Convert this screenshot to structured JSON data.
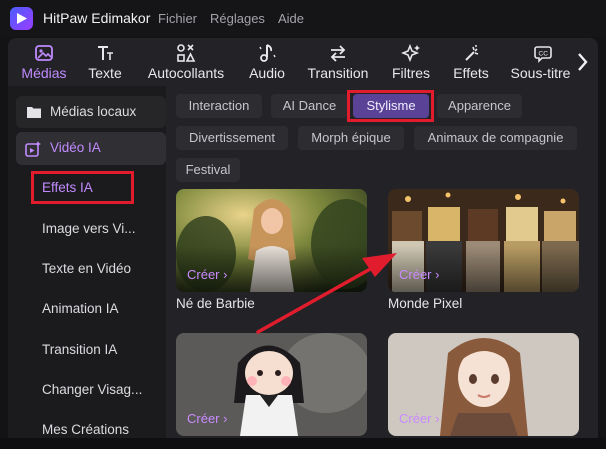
{
  "app": {
    "title": "HitPaw Edimakor"
  },
  "menu": {
    "items": [
      "Fichier",
      "Réglages",
      "Aide"
    ]
  },
  "toolbar": {
    "items": [
      {
        "label": "Médias",
        "icon": "media-icon"
      },
      {
        "label": "Texte",
        "icon": "text-icon"
      },
      {
        "label": "Autocollants",
        "icon": "stickers-icon"
      },
      {
        "label": "Audio",
        "icon": "audio-icon"
      },
      {
        "label": "Transition",
        "icon": "transition-icon"
      },
      {
        "label": "Filtres",
        "icon": "filters-icon"
      },
      {
        "label": "Effets",
        "icon": "effects-icon"
      },
      {
        "label": "Sous-titres",
        "icon": "subtitles-icon"
      }
    ],
    "active": "Médias",
    "next_icon": "chevron-right-icon"
  },
  "sidebar": {
    "items": [
      {
        "label": "Médias locaux",
        "icon": "folder-icon"
      },
      {
        "label": "Vidéo IA",
        "icon": "ai-video-icon"
      },
      {
        "label": "Effets IA"
      },
      {
        "label": "Image vers Vi..."
      },
      {
        "label": "Texte en Vidéo"
      },
      {
        "label": "Animation IA"
      },
      {
        "label": "Transition IA"
      },
      {
        "label": "Changer Visag..."
      },
      {
        "label": "Mes Créations"
      }
    ]
  },
  "categories": {
    "items": [
      "Interaction",
      "AI Dance",
      "Stylisme",
      "Apparence",
      "Divertissement",
      "Morph épique",
      "Animaux de compagnie",
      "Festival"
    ],
    "active": "Stylisme"
  },
  "cards": [
    {
      "title": "Né de Barbie",
      "cta": "Créer ›"
    },
    {
      "title": "Monde Pixel",
      "cta": "Créer ›"
    },
    {
      "title": "",
      "cta": "Créer ›"
    },
    {
      "title": "",
      "cta": "Créer ›"
    }
  ],
  "colors": {
    "accent": "#c08bff",
    "active_chip": "#5a4396",
    "highlight": "#e11d2d",
    "arrow": "#e11d2d"
  }
}
